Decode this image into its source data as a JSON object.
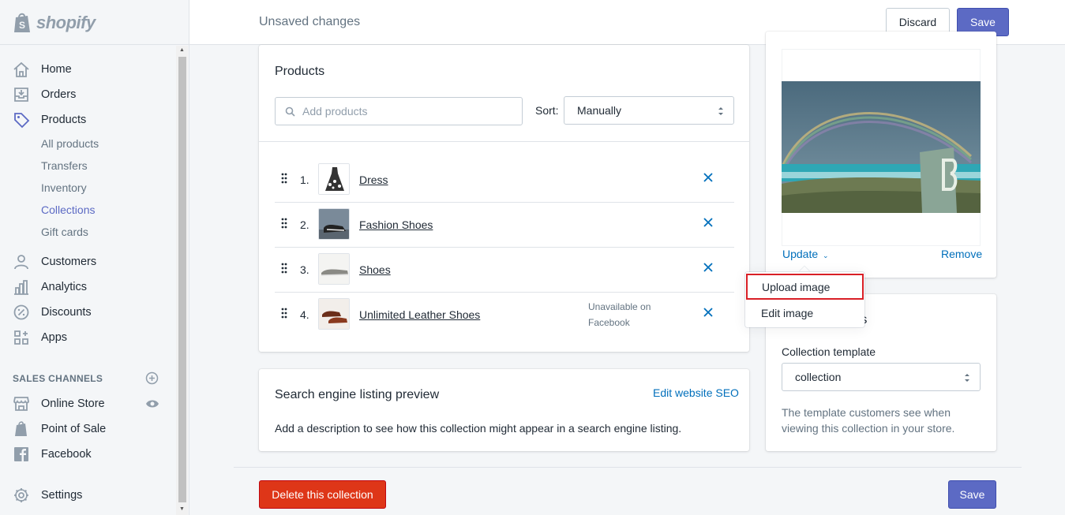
{
  "brand": {
    "name": "shopify"
  },
  "sidebar": {
    "nav": [
      {
        "label": "Home",
        "icon": "home-icon"
      },
      {
        "label": "Orders",
        "icon": "orders-icon"
      },
      {
        "label": "Products",
        "icon": "tag-icon"
      }
    ],
    "product_sub": [
      {
        "label": "All products"
      },
      {
        "label": "Transfers"
      },
      {
        "label": "Inventory"
      },
      {
        "label": "Collections",
        "active": true
      },
      {
        "label": "Gift cards"
      }
    ],
    "nav2": [
      {
        "label": "Customers",
        "icon": "customers-icon"
      },
      {
        "label": "Analytics",
        "icon": "analytics-icon"
      },
      {
        "label": "Discounts",
        "icon": "discounts-icon"
      },
      {
        "label": "Apps",
        "icon": "apps-icon"
      }
    ],
    "sales_channels_title": "SALES CHANNELS",
    "channels": [
      {
        "label": "Online Store",
        "icon": "store-icon"
      },
      {
        "label": "Point of Sale",
        "icon": "pos-bag-icon"
      },
      {
        "label": "Facebook",
        "icon": "facebook-icon"
      }
    ],
    "settings": {
      "label": "Settings",
      "icon": "gear-icon"
    }
  },
  "topbar": {
    "title": "Unsaved changes",
    "discard": "Discard",
    "save": "Save"
  },
  "products": {
    "title": "Products",
    "search_placeholder": "Add products",
    "sort_label": "Sort:",
    "sort_value": "Manually",
    "items": [
      {
        "num": "1.",
        "name": "Dress",
        "note": ""
      },
      {
        "num": "2.",
        "name": "Fashion Shoes",
        "note": ""
      },
      {
        "num": "3.",
        "name": "Shoes",
        "note": ""
      },
      {
        "num": "4.",
        "name": "Unlimited Leather Shoes",
        "note": "Unavailable on Facebook"
      }
    ]
  },
  "seo": {
    "title": "Search engine listing preview",
    "edit": "Edit website SEO",
    "description": "Add a description to see how this collection might appear in a search engine listing."
  },
  "footer": {
    "delete": "Delete this collection",
    "save": "Save"
  },
  "image_card": {
    "update": "Update",
    "remove": "Remove"
  },
  "popover": {
    "upload": "Upload image",
    "edit": "Edit image"
  },
  "template": {
    "title_visible": "tes",
    "label": "Collection template",
    "value": "collection",
    "help": "The template customers see when viewing this collection in your store."
  },
  "colors": {
    "accent": "#5c6ac4",
    "danger": "#de3618",
    "link": "#006fbb",
    "highlight": "#d91f26"
  }
}
